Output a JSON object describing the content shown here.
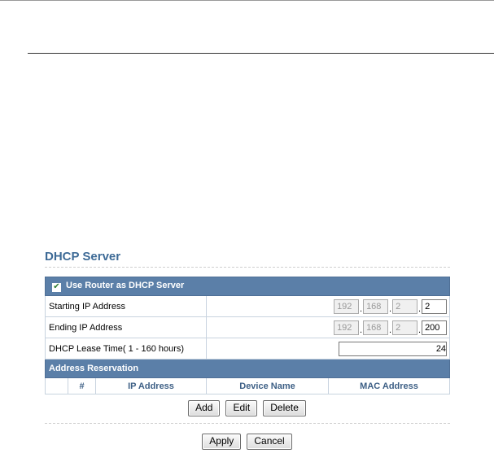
{
  "page": {
    "title": "DHCP Server"
  },
  "dhcp": {
    "enable_label": "Use Router as DHCP Server",
    "enabled": true,
    "start_label": "Starting IP Address",
    "start_ip": [
      "192",
      "168",
      "2",
      "2"
    ],
    "end_label": "Ending IP Address",
    "end_ip": [
      "192",
      "168",
      "2",
      "200"
    ],
    "lease_label": "DHCP Lease Time( 1 - 160 hours)",
    "lease_value": "24"
  },
  "reservation": {
    "title": "Address Reservation",
    "columns": [
      "#",
      "IP Address",
      "Device Name",
      "MAC Address"
    ],
    "rows": []
  },
  "buttons": {
    "add": "Add",
    "edit": "Edit",
    "delete": "Delete",
    "apply": "Apply",
    "cancel": "Cancel"
  }
}
